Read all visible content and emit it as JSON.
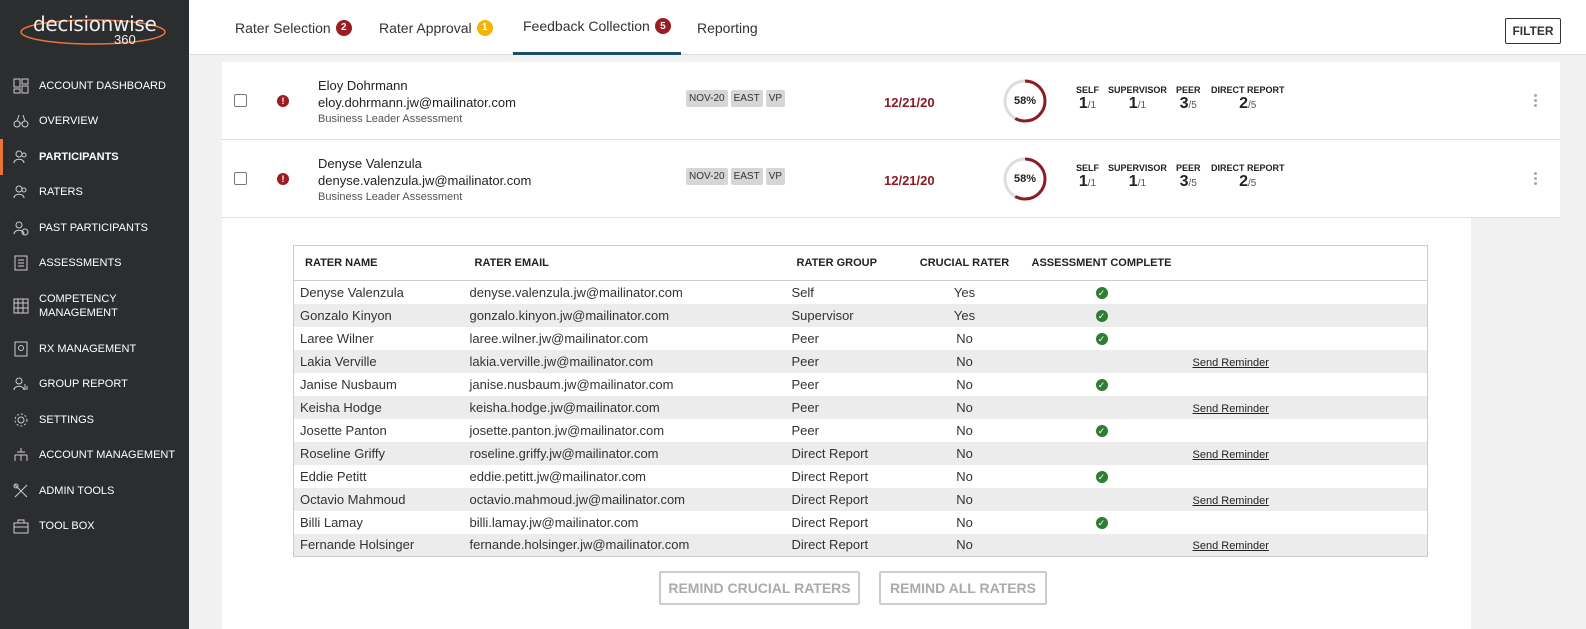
{
  "brand": {
    "name": "decisionwise",
    "suffix": "360"
  },
  "sidebar": {
    "items": [
      {
        "label": "ACCOUNT DASHBOARD",
        "icon": "dashboard-icon"
      },
      {
        "label": "OVERVIEW",
        "icon": "binoculars-icon"
      },
      {
        "label": "PARTICIPANTS",
        "icon": "participants-icon",
        "active": true
      },
      {
        "label": "RATERS",
        "icon": "raters-icon"
      },
      {
        "label": "PAST PARTICIPANTS",
        "icon": "past-participants-icon"
      },
      {
        "label": "ASSESSMENTS",
        "icon": "assessments-icon"
      },
      {
        "label": "COMPETENCY MANAGEMENT",
        "icon": "competency-icon"
      },
      {
        "label": "RX MANAGEMENT",
        "icon": "rx-icon"
      },
      {
        "label": "GROUP REPORT",
        "icon": "group-report-icon"
      },
      {
        "label": "SETTINGS",
        "icon": "gear-icon"
      },
      {
        "label": "ACCOUNT MANAGEMENT",
        "icon": "account-management-icon"
      },
      {
        "label": "ADMIN TOOLS",
        "icon": "tools-icon"
      },
      {
        "label": "TOOL BOX",
        "icon": "toolbox-icon"
      }
    ]
  },
  "tabs": [
    {
      "label": "Rater Selection",
      "badge": "2",
      "badge_color": "#9c1c24"
    },
    {
      "label": "Rater Approval",
      "badge": "1",
      "badge_color": "#f5b400"
    },
    {
      "label": "Feedback Collection",
      "badge": "5",
      "badge_color": "#9c1c24",
      "active": true
    },
    {
      "label": "Reporting"
    }
  ],
  "filter_label": "FILTER",
  "participants": [
    {
      "name": "Eloy Dohrmann",
      "email": "eloy.dohrmann.jw@mailinator.com",
      "assessment": "Business Leader Assessment",
      "tags": [
        "NOV-20",
        "EAST",
        "VP"
      ],
      "due": "12/21/20",
      "progress": "58%",
      "progress_value": 0.58,
      "stats": [
        {
          "label": "SELF",
          "value": "1",
          "total": "/1"
        },
        {
          "label": "SUPERVISOR",
          "value": "1",
          "total": "/1"
        },
        {
          "label": "PEER",
          "value": "3",
          "total": "/5"
        },
        {
          "label": "DIRECT REPORT",
          "value": "2",
          "total": "/5"
        }
      ]
    },
    {
      "name": "Denyse Valenzula",
      "email": "denyse.valenzula.jw@mailinator.com",
      "assessment": "Business Leader Assessment",
      "tags": [
        "NOV-20",
        "EAST",
        "VP"
      ],
      "due": "12/21/20",
      "progress": "58%",
      "progress_value": 0.58,
      "stats": [
        {
          "label": "SELF",
          "value": "1",
          "total": "/1"
        },
        {
          "label": "SUPERVISOR",
          "value": "1",
          "total": "/1"
        },
        {
          "label": "PEER",
          "value": "3",
          "total": "/5"
        },
        {
          "label": "DIRECT REPORT",
          "value": "2",
          "total": "/5"
        }
      ]
    }
  ],
  "rater_table": {
    "headers": [
      "RATER NAME",
      "RATER EMAIL",
      "RATER GROUP",
      "CRUCIAL RATER",
      "ASSESSMENT COMPLETE"
    ],
    "reminder_label": "Send Reminder",
    "rows": [
      {
        "name": "Denyse Valenzula",
        "email": "denyse.valenzula.jw@mailinator.com",
        "group": "Self",
        "crucial": "Yes",
        "complete": true
      },
      {
        "name": "Gonzalo Kinyon",
        "email": "gonzalo.kinyon.jw@mailinator.com",
        "group": "Supervisor",
        "crucial": "Yes",
        "complete": true
      },
      {
        "name": "Laree Wilner",
        "email": "laree.wilner.jw@mailinator.com",
        "group": "Peer",
        "crucial": "No",
        "complete": true
      },
      {
        "name": "Lakia Verville",
        "email": "lakia.verville.jw@mailinator.com",
        "group": "Peer",
        "crucial": "No",
        "complete": false
      },
      {
        "name": "Janise Nusbaum",
        "email": "janise.nusbaum.jw@mailinator.com",
        "group": "Peer",
        "crucial": "No",
        "complete": true
      },
      {
        "name": "Keisha Hodge",
        "email": "keisha.hodge.jw@mailinator.com",
        "group": "Peer",
        "crucial": "No",
        "complete": false
      },
      {
        "name": "Josette Panton",
        "email": "josette.panton.jw@mailinator.com",
        "group": "Peer",
        "crucial": "No",
        "complete": true
      },
      {
        "name": "Roseline Griffy",
        "email": "roseline.griffy.jw@mailinator.com",
        "group": "Direct Report",
        "crucial": "No",
        "complete": false
      },
      {
        "name": "Eddie Petitt",
        "email": "eddie.petitt.jw@mailinator.com",
        "group": "Direct Report",
        "crucial": "No",
        "complete": true
      },
      {
        "name": "Octavio Mahmoud",
        "email": "octavio.mahmoud.jw@mailinator.com",
        "group": "Direct Report",
        "crucial": "No",
        "complete": false
      },
      {
        "name": "Billi Lamay",
        "email": "billi.lamay.jw@mailinator.com",
        "group": "Direct Report",
        "crucial": "No",
        "complete": true
      },
      {
        "name": "Fernande Holsinger",
        "email": "fernande.holsinger.jw@mailinator.com",
        "group": "Direct Report",
        "crucial": "No",
        "complete": false
      }
    ]
  },
  "actions": {
    "remind_crucial": "REMIND CRUCIAL RATERS",
    "remind_all": "REMIND ALL RATERS"
  },
  "colors": {
    "accent": "#e8743b",
    "danger": "#9c1c24",
    "success": "#2e7d32",
    "sidebar_bg": "#2b2d2f"
  }
}
